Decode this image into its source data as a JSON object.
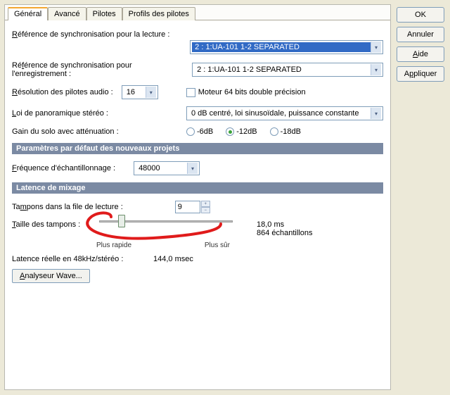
{
  "tabs": {
    "general": "Général",
    "advanced": "Avancé",
    "drivers": "Pilotes",
    "driver_profiles": "Profils des pilotes"
  },
  "labels": {
    "playback_sync_ref": "Référence de synchronisation pour la lecture :",
    "record_sync_ref": "Référence de synchronisation pour l'enregistrement :",
    "driver_resolution": "Résolution des pilotes audio :",
    "engine_64bit": "Moteur 64 bits double précision",
    "pan_law": "Loi de panoramique stéréo :",
    "solo_gain": "Gain du solo avec atténuation :",
    "sample_rate": "Fréquence d'échantillonnage :",
    "buffers_in_queue": "Tampons dans la file de lecture :",
    "buffer_size": "Taille des tampons :",
    "faster": "Plus rapide",
    "safer": "Plus sûr",
    "real_latency": "Latence réelle en 48kHz/stéréo :",
    "wave_profiler": "Analyseur Wave..."
  },
  "values": {
    "playback_sync": "2 : 1:UA-101 1-2 SEPARATED",
    "record_sync": "2 : 1:UA-101 1-2 SEPARATED",
    "driver_resolution": "16",
    "pan_law": "0 dB centré, loi sinusoïdale, puissance constante",
    "sample_rate": "48000",
    "buffers_in_queue": "9",
    "latency_ms": "18,0 ms",
    "latency_samples": "864 échantillons",
    "real_latency": "144,0 msec"
  },
  "radios": {
    "minus6": "-6dB",
    "minus12": "-12dB",
    "minus18": "-18dB"
  },
  "sections": {
    "defaults": "Paramètres par défaut des nouveaux projets",
    "mixing_latency": "Latence de mixage"
  },
  "buttons": {
    "ok": "OK",
    "cancel": "Annuler",
    "help": "Aide",
    "apply": "Appliquer"
  }
}
